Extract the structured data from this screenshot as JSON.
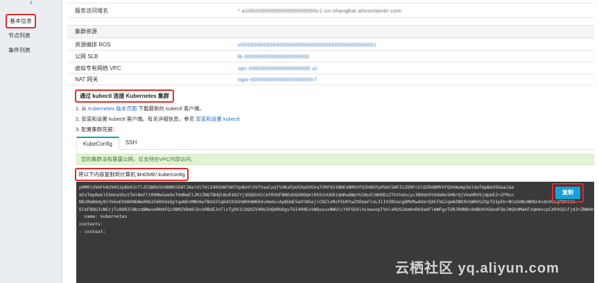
{
  "sidebar": {
    "collapse_icon": "chevron-left-icon",
    "items": [
      {
        "label": "基本信息",
        "active": true
      },
      {
        "label": "节点列表",
        "active": false
      },
      {
        "label": "事件列表",
        "active": false
      }
    ]
  },
  "service": {
    "key": "服务访问域名",
    "value": "*.a1002000000000000000000c1.cn-shanghai.alicontainer.com"
  },
  "resources": {
    "title": "集群资源",
    "rows": [
      {
        "key": "资源编排 ROS",
        "value": "c000000000000000000000000000000000000000001"
      },
      {
        "key": "公网 SLB",
        "value": "lb-00000000000000000000"
      },
      {
        "key": "虚拟专有网络 VPC",
        "value": "vpc-0000000000000000000 ui"
      },
      {
        "key": "NAT 网关",
        "value": "ngw-0000000000000000000r7"
      }
    ]
  },
  "connect": {
    "title": "通过 kubectl 连接 Kubernetes 集群",
    "step1_prefix": "1. 从 ",
    "step1_link": "Kubernetes 版本页面",
    "step1_suffix": " 下载最新的 kubectl 客户端。",
    "step2_prefix": "2. 安装和设置 kubectl 客户端。有关详细信息，参见 ",
    "step2_link": "安装和设置 kubectl",
    "step3": "3. 配置集群凭据："
  },
  "tabs": [
    {
      "label": "KubeConfig",
      "active": true
    },
    {
      "label": "SSH",
      "active": false
    }
  ],
  "notice": "您的集群没有暴露公网，仅支持在VPC内部访问。",
  "copy_instruction": "将以下内容复制到计算机 $HOME/.kube/config",
  "copy_button": "复制",
  "code": "pNM0lUVmFkN294S2pBb0JnTlZCQW9USVdNMU5EWTJNalUlTmlZd05UWTAKTXpBeVlXVTVaalpqTVdKaFpUSXpOVGhqTVRFUU1BNEdBMVVFQ3hNSFpHVmlSWFZzZERFcUlDZ0dBMVVFQXhNaApSelUwTmpBeU5UaaJaa\nkExTmpRekl5SmhaVGxtTmlNeFlt00MwGak0xT0dNeElJR2ZNQTBHQlNxR1NJYj3DQEUVCCkFRVUFBNEdGQURDQmlRS0JnUURiQmRwQWpYU1NuSlNHODzZTUthdncyc3B0bE0YOdkNvSHNrQjVVeHRVSjdpbE2+ZFMcn\nNDzRmBkdy9iYk6eEVkNVNUWe006256RXdsQytqeNEnMNV6eTBnU3Iq6dtXSGhW00dW60dvXmdxcApBUmE5eUlNSejlCN2loMzFGU0twZXEmaFlnL3lIV3BVangDMVRwdGkrQXhTbGJqeWZBR3hSWHVGZXpTU1pEhrBCeS0BvNKNz4vdnV0LqPBtCC1\nECkFBQUJvNEcjTu9XR3lBbzdBNwvkRHdFQi9BMZVBd0lDckRBUEJnTlzTyDV1COQ0ZV4RUJUQURUUgvTUI4R0ExVWQxxuxNWUlcYUFGSVlhLkwxnpTVnlxRUS2bm0xRk9adFlmWFgvTURJR0NDc0dBUVVGQndFQkJHQXdMakFzQmdncpCX0VGQlFjd3rZWWdheFIwY0VvckwyMnxjbiJ00vG1GamN5OVRURWUjlq7xNBd05WRURWUjBmCkJDNBdMMEZ1b0NpR0pvNWhiR2FiwY0RvdkwyTmxjbiJ6T01GamN5NWhiR2xiYZFc0dVkyOXRMM0p2YjNRdVkzSmMKTUEWRU0N7UdTSWIxRFFF0NEMEQVFBNEdCQUJDWiAwTzBlbU9KSHFYeWFsZktYbkQ4SVc4YXF0VDNtTMXFNEcUH0dwpPaDQvcHdHbm5kVWdGalJpbDS1R1NKdWR5NGNmQ3RGa2olb3pReEdLKOUrKlJCMzBnYTd3MzVYOEpSMlFDT3BHCk0rdlJnVVpFNG1PYjNlcTJ1WWt5b095OTRvOUxEd2NVOFFaUhwQisxdWdTMHAlTlRzOG9SREJOaU9pQlZVGQXMFlKeAotLS0tLUVORCBDRVJUSUZJQ0FURS0tLS0tCg=\n  name: kubernetes\ncontexts:\n- context:"
}
